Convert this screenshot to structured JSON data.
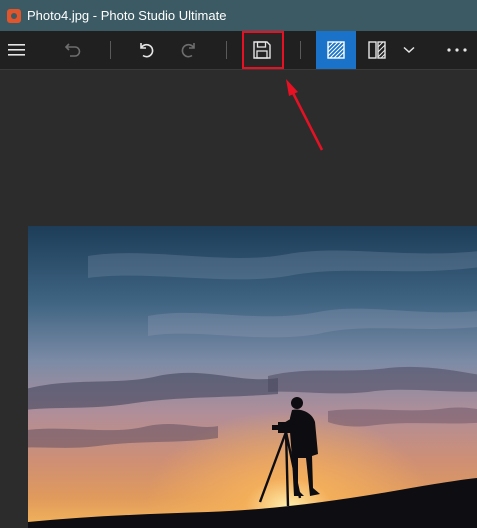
{
  "window": {
    "title": "Photo4.jpg - Photo Studio Ultimate"
  },
  "toolbar": {
    "menu_icon": "hamburger-menu-icon",
    "undo_icon": "undo-icon",
    "rotate_left_icon": "rotate-left-icon",
    "rotate_right_icon": "rotate-right-icon",
    "save_icon": "floppy-disk-save-icon",
    "view_single_icon": "single-view-icon",
    "view_compare_icon": "compare-view-icon",
    "view_dropdown_icon": "chevron-down-icon",
    "more_icon": "more-options-icon"
  },
  "colors": {
    "titlebar": "#3c5a63",
    "toolbar": "#202020",
    "canvas": "#2c2c2c",
    "accent": "#1a73c9",
    "highlight": "#e81123"
  },
  "annotation": {
    "type": "red-arrow",
    "target": "save-button"
  }
}
